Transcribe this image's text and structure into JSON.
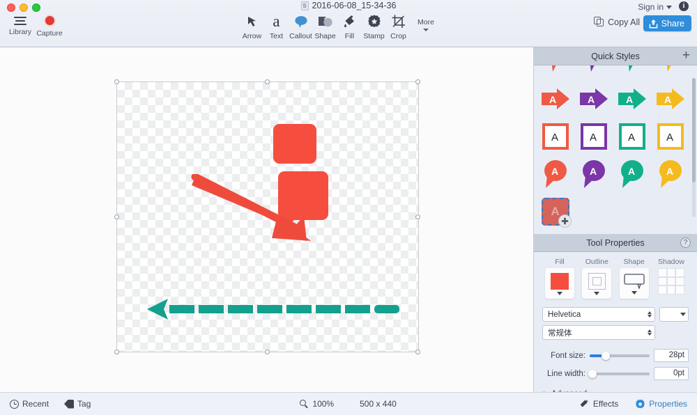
{
  "window": {
    "title": "2016-06-08_15-34-36",
    "doc_icon_letter": "S",
    "traffic_lights": [
      "close",
      "minimize",
      "zoom"
    ]
  },
  "topbar": {
    "left_tools": [
      {
        "label": "Library",
        "icon": "hamburger-icon"
      },
      {
        "label": "Capture",
        "icon": "record-dot-icon"
      }
    ],
    "center_tools": [
      {
        "label": "Arrow",
        "icon": "arrow-icon"
      },
      {
        "label": "Text",
        "icon": "text-a-icon"
      },
      {
        "label": "Callout",
        "icon": "callout-bubble-icon"
      },
      {
        "label": "Shape",
        "icon": "shape-icon"
      },
      {
        "label": "Fill",
        "icon": "paint-bucket-icon"
      },
      {
        "label": "Stamp",
        "icon": "stamp-icon"
      },
      {
        "label": "Crop",
        "icon": "crop-icon"
      }
    ],
    "more_label": "More",
    "sign_in_label": "Sign in",
    "info_label": "i",
    "copy_all_label": "Copy All",
    "share_label": "Share",
    "share_color": "#2f8ddb"
  },
  "canvas": {
    "image_size": "500 x 440",
    "shapes": [
      {
        "name": "red-callout-top",
        "color": "#f54e3f",
        "type": "rounded-rect"
      },
      {
        "name": "red-callout-body",
        "color": "#f54e3f",
        "type": "callout"
      },
      {
        "name": "red-arrow",
        "color": "#ef4b3c",
        "type": "arrow"
      },
      {
        "name": "teal-dashed-arrow",
        "color": "#13a18e",
        "type": "dashed-arrow"
      }
    ]
  },
  "quick_styles": {
    "title": "Quick Styles",
    "add_label": "+",
    "colors": {
      "red": "#f05a44",
      "purple": "#7b36a8",
      "teal": "#11b08b",
      "yellow": "#f5bb1d"
    },
    "rows": [
      {
        "shape": "callout-tail",
        "letter": ""
      },
      {
        "shape": "arrow-right",
        "letter": "A"
      },
      {
        "shape": "outline-box",
        "letter": "A"
      },
      {
        "shape": "speech-bubble",
        "letter": "A"
      }
    ],
    "selected": {
      "letter": "A",
      "fill": "#d4635c",
      "badge": "plus-icon"
    }
  },
  "tool_properties": {
    "title": "Tool Properties",
    "help_label": "?",
    "attributes": [
      {
        "label": "Fill",
        "icon": "fill-swatch-icon",
        "value": "#f54e3f"
      },
      {
        "label": "Outline",
        "icon": "outline-swatch-icon",
        "value": "none"
      },
      {
        "label": "Shape",
        "icon": "callout-shape-icon",
        "value": "callout"
      },
      {
        "label": "Shadow",
        "icon": "shadow-grid-icon",
        "value": "none"
      }
    ],
    "font_family": "Helvetica",
    "font_style": "常规体",
    "text_color": "#ffffff",
    "font_size_label": "Font size:",
    "font_size_value": "28pt",
    "font_size_percent": 22,
    "line_width_label": "Line width:",
    "line_width_value": "0pt",
    "line_width_percent": 0,
    "advanced_label": "Advanced"
  },
  "bottombar": {
    "recent_label": "Recent",
    "tag_label": "Tag",
    "zoom_label": "100%",
    "size_label": "500 x 440",
    "effects_label": "Effects",
    "properties_label": "Properties"
  }
}
